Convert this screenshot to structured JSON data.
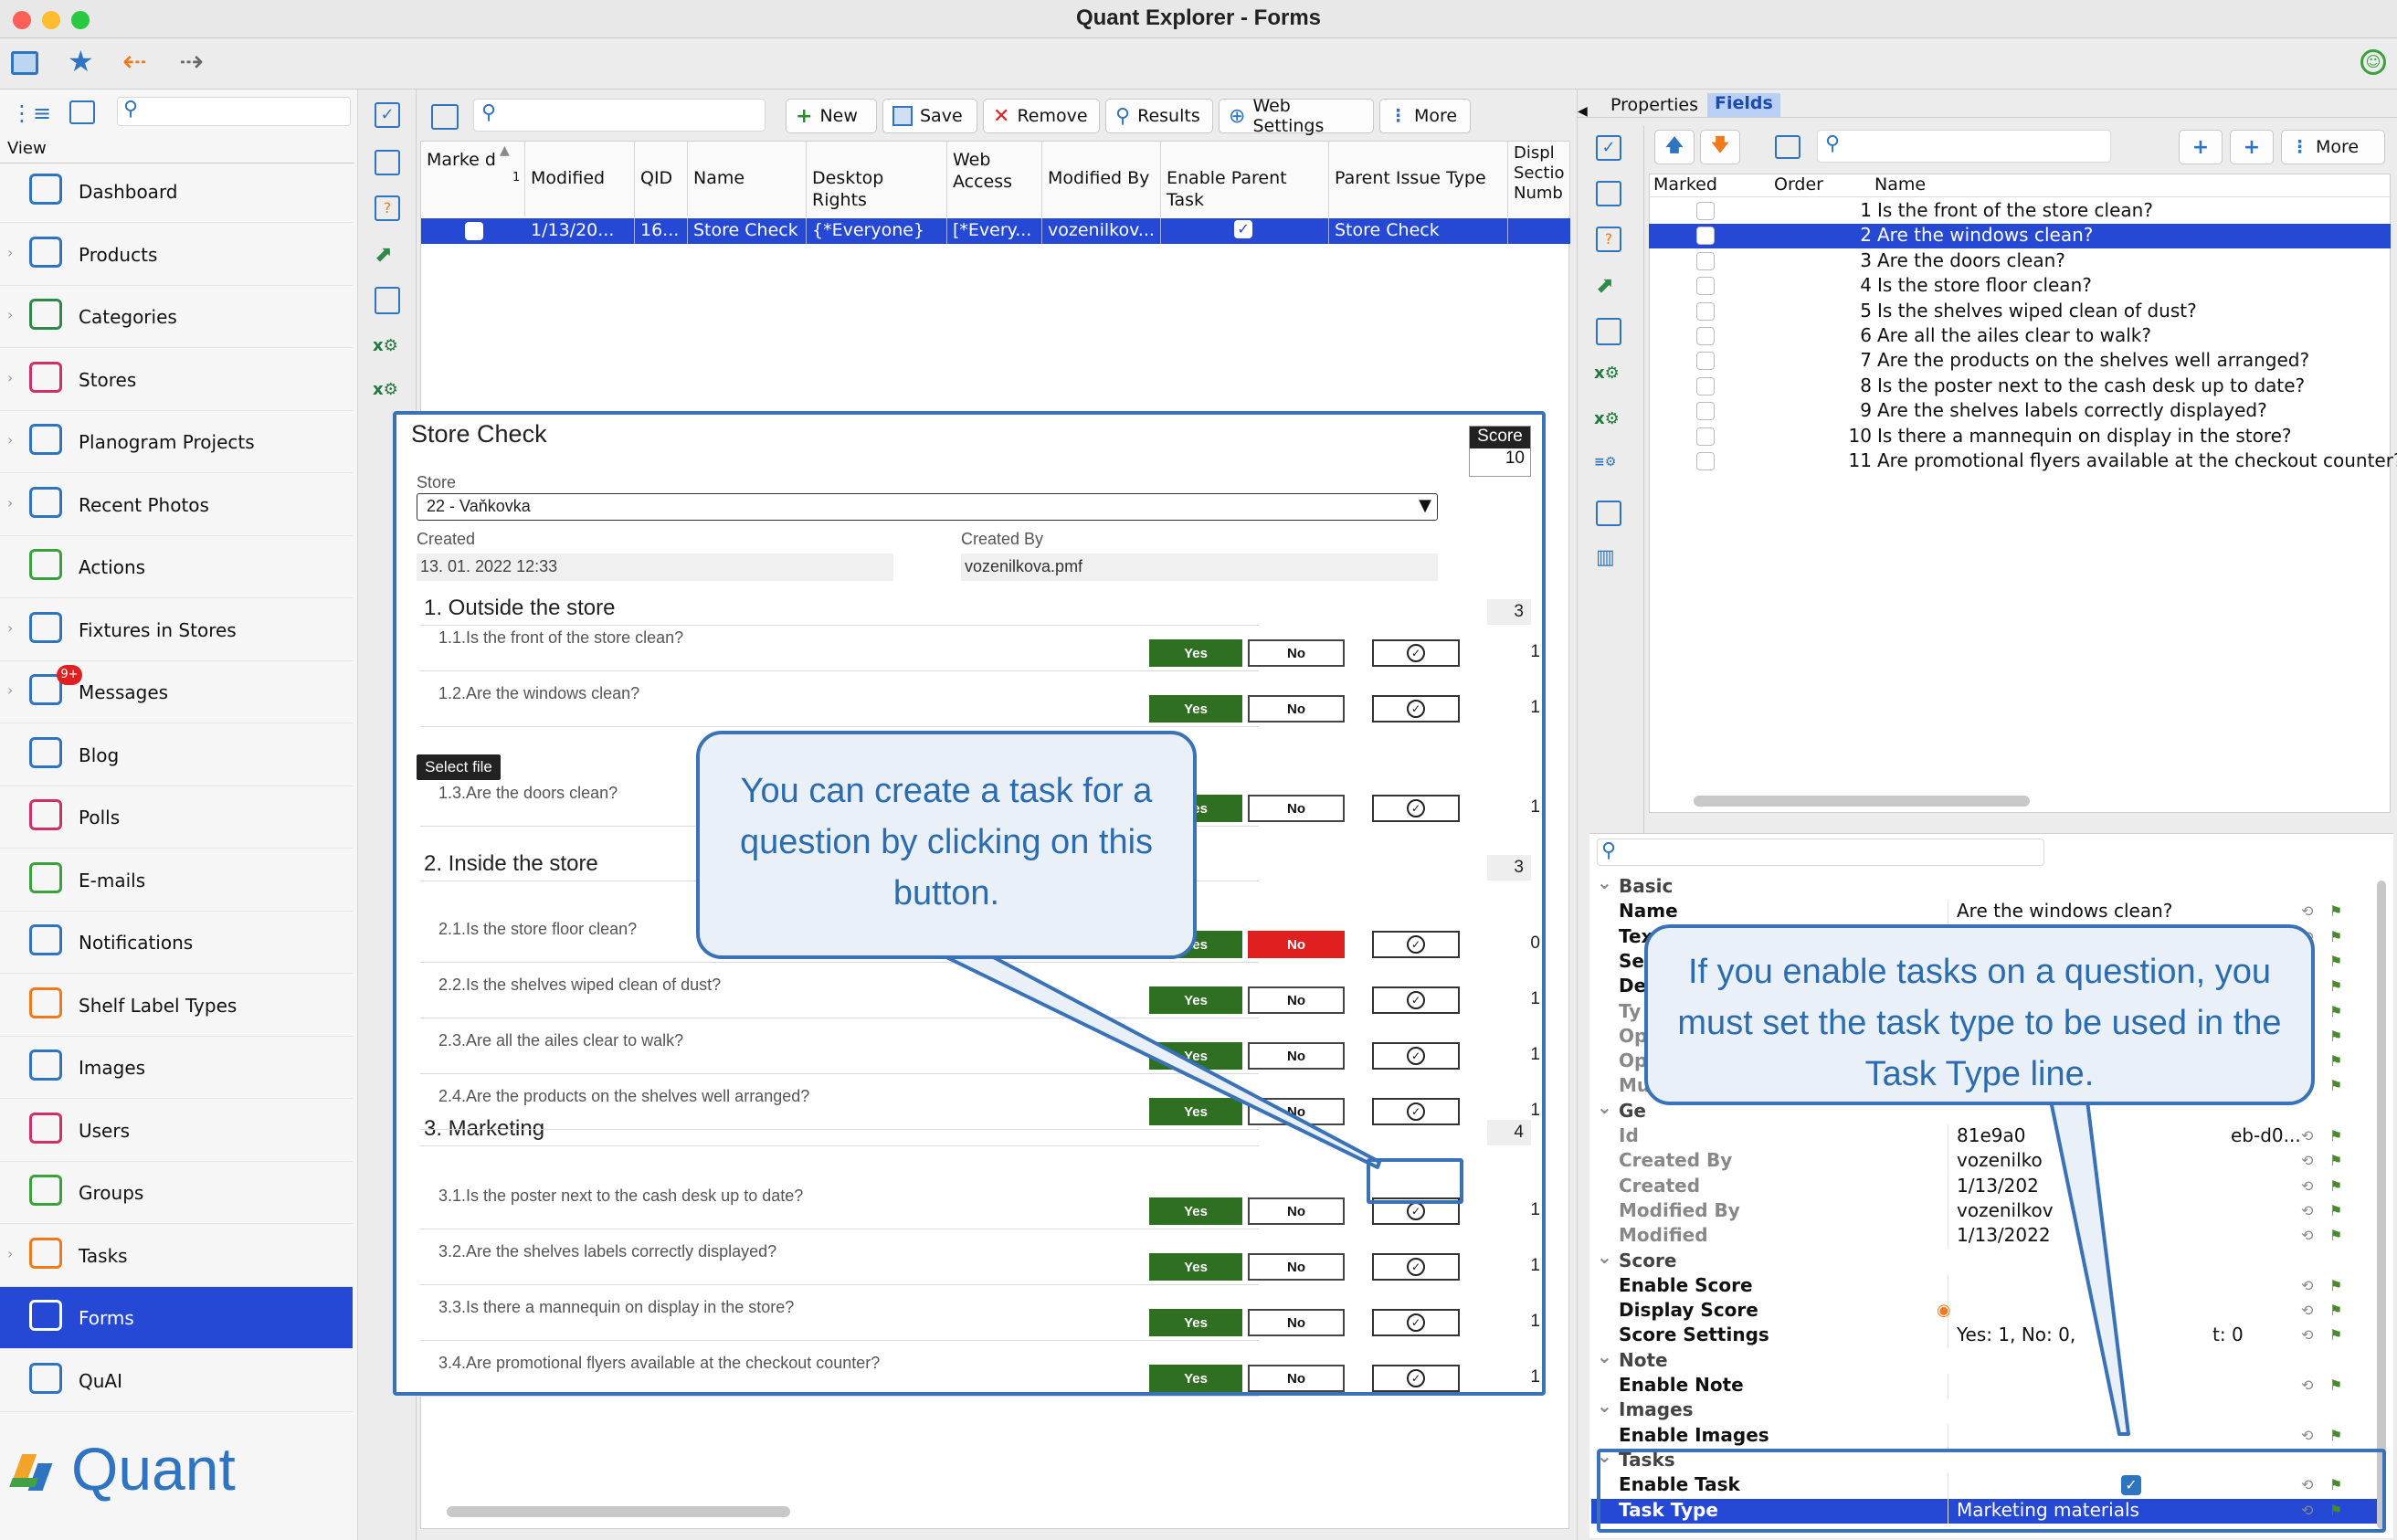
{
  "window": {
    "title": "Quant Explorer - Forms"
  },
  "sidebar": {
    "view_label": "View",
    "items": [
      {
        "label": "Dashboard",
        "icon": "dashboard-icon"
      },
      {
        "label": "Products",
        "icon": "products-icon"
      },
      {
        "label": "Categories",
        "icon": "categories-icon"
      },
      {
        "label": "Stores",
        "icon": "stores-icon"
      },
      {
        "label": "Planogram Projects",
        "icon": "planogram-icon"
      },
      {
        "label": "Recent Photos",
        "icon": "camera-icon"
      },
      {
        "label": "Actions",
        "icon": "actions-icon"
      },
      {
        "label": "Fixtures in Stores",
        "icon": "fixtures-icon"
      },
      {
        "label": "Messages",
        "icon": "messages-icon",
        "badge": "9+"
      },
      {
        "label": "Blog",
        "icon": "blog-icon"
      },
      {
        "label": "Polls",
        "icon": "polls-icon"
      },
      {
        "label": "E-mails",
        "icon": "email-icon"
      },
      {
        "label": "Notifications",
        "icon": "bell-icon"
      },
      {
        "label": "Shelf Label Types",
        "icon": "shelf-label-icon"
      },
      {
        "label": "Images",
        "icon": "images-icon"
      },
      {
        "label": "Users",
        "icon": "user-icon"
      },
      {
        "label": "Groups",
        "icon": "groups-icon"
      },
      {
        "label": "Tasks",
        "icon": "tasks-icon"
      },
      {
        "label": "Forms",
        "icon": "forms-icon",
        "active": true
      },
      {
        "label": "QuAI",
        "icon": "quai-icon"
      }
    ],
    "logo_text": "Quant"
  },
  "toolbar": {
    "new_label": "New",
    "save_label": "Save",
    "remove_label": "Remove",
    "results_label": "Results",
    "web_settings_label": "Web Settings",
    "more_label": "More"
  },
  "grid": {
    "headers": {
      "marked": "Marke d",
      "modified": "Modified",
      "qid": "QID",
      "name": "Name",
      "desktop_rights": "Desktop Rights",
      "web_access": "Web Access",
      "modified_by": "Modified By",
      "enable_parent_task": "Enable Parent Task",
      "parent_issue_type": "Parent Issue Type",
      "display_section": "Displ Sectio Numb"
    },
    "sort_indicator": "1",
    "row": {
      "modified": "1/13/20...",
      "qid": "16...",
      "name": "Store Check",
      "desktop_rights": "{*Everyone}",
      "web_access": "[*Every...",
      "modified_by": "vozenilkov...",
      "parent_issue_type": "Store Check"
    }
  },
  "form": {
    "title": "Store Check",
    "score_label": "Score",
    "score_value": "10",
    "store_label": "Store",
    "store_value": "22 - Vaňkovka",
    "created_label": "Created",
    "created_value": "13. 01. 2022 12:33",
    "created_by_label": "Created By",
    "created_by_value": "vozenilkova.pmf",
    "select_file": "Select file",
    "yes": "Yes",
    "no": "No",
    "sections": [
      {
        "title": "1. Outside the store",
        "score": "3"
      },
      {
        "title": "2. Inside the store",
        "score": "3"
      },
      {
        "title": "3. Marketing",
        "score": "4"
      }
    ],
    "questions": [
      {
        "text": "1.1.Is the front of the store clean?",
        "score": "1"
      },
      {
        "text": "1.2.Are the windows clean?",
        "score": "1"
      },
      {
        "text": "1.3.Are the doors clean?",
        "score": "1"
      },
      {
        "text": "2.1.Is the store floor clean?",
        "score": "0"
      },
      {
        "text": "2.2.Is the shelves wiped clean of dust?",
        "score": "1"
      },
      {
        "text": "2.3.Are all the ailes clear to walk?",
        "score": "1"
      },
      {
        "text": "2.4.Are the products on the shelves well arranged?",
        "score": "1"
      },
      {
        "text": "3.1.Is the poster next to the cash desk up to date?",
        "score": "1"
      },
      {
        "text": "3.2.Are the shelves labels correctly displayed?",
        "score": "1"
      },
      {
        "text": "3.3.Is there a mannequin on display in the store?",
        "score": "1"
      },
      {
        "text": "3.4.Are promotional flyers available at the checkout counter?",
        "score": "1"
      }
    ]
  },
  "callouts": {
    "left": "You can create a task for a question by clicking on this button.",
    "right": "If you enable tasks on a question, you must set the task type to be used in the Task Type line."
  },
  "right_panel": {
    "tab_properties": "Properties",
    "tab_fields": "Fields",
    "more_label": "More",
    "field_headers": {
      "marked": "Marked",
      "order": "Order",
      "name": "Name"
    },
    "fields": [
      {
        "order": "1",
        "name": "Is the front of the store clean?"
      },
      {
        "order": "2",
        "name": "Are the windows clean?",
        "selected": true
      },
      {
        "order": "3",
        "name": "Are the doors clean?"
      },
      {
        "order": "4",
        "name": "Is the store floor clean?"
      },
      {
        "order": "5",
        "name": "Is the shelves wiped clean of dust?"
      },
      {
        "order": "6",
        "name": "Are all the ailes clear to walk?"
      },
      {
        "order": "7",
        "name": "Are the products on the shelves well arranged?"
      },
      {
        "order": "8",
        "name": "Is the poster next to the cash desk up to date?"
      },
      {
        "order": "9",
        "name": "Are the shelves labels correctly displayed?"
      },
      {
        "order": "10",
        "name": "Is there a mannequin on display in the store?"
      },
      {
        "order": "11",
        "name": "Are promotional flyers available at the checkout counter?"
      }
    ],
    "props": {
      "basic": "Basic",
      "name_key": "Name",
      "name_val": "Are the windows clean?",
      "tex": "Tex",
      "sec": "Sec",
      "de": "De",
      "ty": "Ty",
      "op1": "Op",
      "op2": "Op",
      "mu": "Mu",
      "ge": "Ge",
      "id": "Id",
      "id_val_a": "81e9a0",
      "id_val_b": "eb-d0...",
      "created_by": "Created By",
      "created_by_val": "vozenilko",
      "created": "Created",
      "created_val": "1/13/202",
      "modified_by": "Modified By",
      "modified_by_val": "vozenilkov",
      "modified": "Modified",
      "modified_val": "1/13/2022",
      "score": "Score",
      "enable_score": "Enable Score",
      "display_score": "Display Score",
      "score_settings": "Score Settings",
      "score_settings_val_a": "Yes: 1, No: 0,",
      "score_settings_val_b": "t: 0",
      "note": "Note",
      "enable_note": "Enable Note",
      "images": "Images",
      "enable_images": "Enable Images",
      "tasks": "Tasks",
      "enable_task": "Enable Task",
      "task_type": "Task Type",
      "task_type_val": "Marketing materials"
    }
  }
}
